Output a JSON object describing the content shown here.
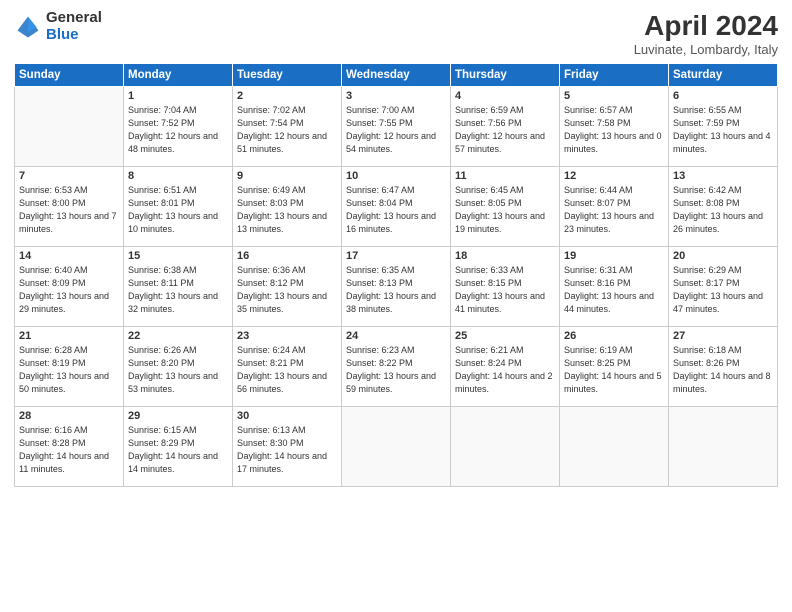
{
  "logo": {
    "general": "General",
    "blue": "Blue"
  },
  "title": "April 2024",
  "location": "Luvinate, Lombardy, Italy",
  "weekdays": [
    "Sunday",
    "Monday",
    "Tuesday",
    "Wednesday",
    "Thursday",
    "Friday",
    "Saturday"
  ],
  "weeks": [
    [
      {
        "day": "",
        "sunrise": "",
        "sunset": "",
        "daylight": ""
      },
      {
        "day": "1",
        "sunrise": "Sunrise: 7:04 AM",
        "sunset": "Sunset: 7:52 PM",
        "daylight": "Daylight: 12 hours and 48 minutes."
      },
      {
        "day": "2",
        "sunrise": "Sunrise: 7:02 AM",
        "sunset": "Sunset: 7:54 PM",
        "daylight": "Daylight: 12 hours and 51 minutes."
      },
      {
        "day": "3",
        "sunrise": "Sunrise: 7:00 AM",
        "sunset": "Sunset: 7:55 PM",
        "daylight": "Daylight: 12 hours and 54 minutes."
      },
      {
        "day": "4",
        "sunrise": "Sunrise: 6:59 AM",
        "sunset": "Sunset: 7:56 PM",
        "daylight": "Daylight: 12 hours and 57 minutes."
      },
      {
        "day": "5",
        "sunrise": "Sunrise: 6:57 AM",
        "sunset": "Sunset: 7:58 PM",
        "daylight": "Daylight: 13 hours and 0 minutes."
      },
      {
        "day": "6",
        "sunrise": "Sunrise: 6:55 AM",
        "sunset": "Sunset: 7:59 PM",
        "daylight": "Daylight: 13 hours and 4 minutes."
      }
    ],
    [
      {
        "day": "7",
        "sunrise": "Sunrise: 6:53 AM",
        "sunset": "Sunset: 8:00 PM",
        "daylight": "Daylight: 13 hours and 7 minutes."
      },
      {
        "day": "8",
        "sunrise": "Sunrise: 6:51 AM",
        "sunset": "Sunset: 8:01 PM",
        "daylight": "Daylight: 13 hours and 10 minutes."
      },
      {
        "day": "9",
        "sunrise": "Sunrise: 6:49 AM",
        "sunset": "Sunset: 8:03 PM",
        "daylight": "Daylight: 13 hours and 13 minutes."
      },
      {
        "day": "10",
        "sunrise": "Sunrise: 6:47 AM",
        "sunset": "Sunset: 8:04 PM",
        "daylight": "Daylight: 13 hours and 16 minutes."
      },
      {
        "day": "11",
        "sunrise": "Sunrise: 6:45 AM",
        "sunset": "Sunset: 8:05 PM",
        "daylight": "Daylight: 13 hours and 19 minutes."
      },
      {
        "day": "12",
        "sunrise": "Sunrise: 6:44 AM",
        "sunset": "Sunset: 8:07 PM",
        "daylight": "Daylight: 13 hours and 23 minutes."
      },
      {
        "day": "13",
        "sunrise": "Sunrise: 6:42 AM",
        "sunset": "Sunset: 8:08 PM",
        "daylight": "Daylight: 13 hours and 26 minutes."
      }
    ],
    [
      {
        "day": "14",
        "sunrise": "Sunrise: 6:40 AM",
        "sunset": "Sunset: 8:09 PM",
        "daylight": "Daylight: 13 hours and 29 minutes."
      },
      {
        "day": "15",
        "sunrise": "Sunrise: 6:38 AM",
        "sunset": "Sunset: 8:11 PM",
        "daylight": "Daylight: 13 hours and 32 minutes."
      },
      {
        "day": "16",
        "sunrise": "Sunrise: 6:36 AM",
        "sunset": "Sunset: 8:12 PM",
        "daylight": "Daylight: 13 hours and 35 minutes."
      },
      {
        "day": "17",
        "sunrise": "Sunrise: 6:35 AM",
        "sunset": "Sunset: 8:13 PM",
        "daylight": "Daylight: 13 hours and 38 minutes."
      },
      {
        "day": "18",
        "sunrise": "Sunrise: 6:33 AM",
        "sunset": "Sunset: 8:15 PM",
        "daylight": "Daylight: 13 hours and 41 minutes."
      },
      {
        "day": "19",
        "sunrise": "Sunrise: 6:31 AM",
        "sunset": "Sunset: 8:16 PM",
        "daylight": "Daylight: 13 hours and 44 minutes."
      },
      {
        "day": "20",
        "sunrise": "Sunrise: 6:29 AM",
        "sunset": "Sunset: 8:17 PM",
        "daylight": "Daylight: 13 hours and 47 minutes."
      }
    ],
    [
      {
        "day": "21",
        "sunrise": "Sunrise: 6:28 AM",
        "sunset": "Sunset: 8:19 PM",
        "daylight": "Daylight: 13 hours and 50 minutes."
      },
      {
        "day": "22",
        "sunrise": "Sunrise: 6:26 AM",
        "sunset": "Sunset: 8:20 PM",
        "daylight": "Daylight: 13 hours and 53 minutes."
      },
      {
        "day": "23",
        "sunrise": "Sunrise: 6:24 AM",
        "sunset": "Sunset: 8:21 PM",
        "daylight": "Daylight: 13 hours and 56 minutes."
      },
      {
        "day": "24",
        "sunrise": "Sunrise: 6:23 AM",
        "sunset": "Sunset: 8:22 PM",
        "daylight": "Daylight: 13 hours and 59 minutes."
      },
      {
        "day": "25",
        "sunrise": "Sunrise: 6:21 AM",
        "sunset": "Sunset: 8:24 PM",
        "daylight": "Daylight: 14 hours and 2 minutes."
      },
      {
        "day": "26",
        "sunrise": "Sunrise: 6:19 AM",
        "sunset": "Sunset: 8:25 PM",
        "daylight": "Daylight: 14 hours and 5 minutes."
      },
      {
        "day": "27",
        "sunrise": "Sunrise: 6:18 AM",
        "sunset": "Sunset: 8:26 PM",
        "daylight": "Daylight: 14 hours and 8 minutes."
      }
    ],
    [
      {
        "day": "28",
        "sunrise": "Sunrise: 6:16 AM",
        "sunset": "Sunset: 8:28 PM",
        "daylight": "Daylight: 14 hours and 11 minutes."
      },
      {
        "day": "29",
        "sunrise": "Sunrise: 6:15 AM",
        "sunset": "Sunset: 8:29 PM",
        "daylight": "Daylight: 14 hours and 14 minutes."
      },
      {
        "day": "30",
        "sunrise": "Sunrise: 6:13 AM",
        "sunset": "Sunset: 8:30 PM",
        "daylight": "Daylight: 14 hours and 17 minutes."
      },
      {
        "day": "",
        "sunrise": "",
        "sunset": "",
        "daylight": ""
      },
      {
        "day": "",
        "sunrise": "",
        "sunset": "",
        "daylight": ""
      },
      {
        "day": "",
        "sunrise": "",
        "sunset": "",
        "daylight": ""
      },
      {
        "day": "",
        "sunrise": "",
        "sunset": "",
        "daylight": ""
      }
    ]
  ]
}
